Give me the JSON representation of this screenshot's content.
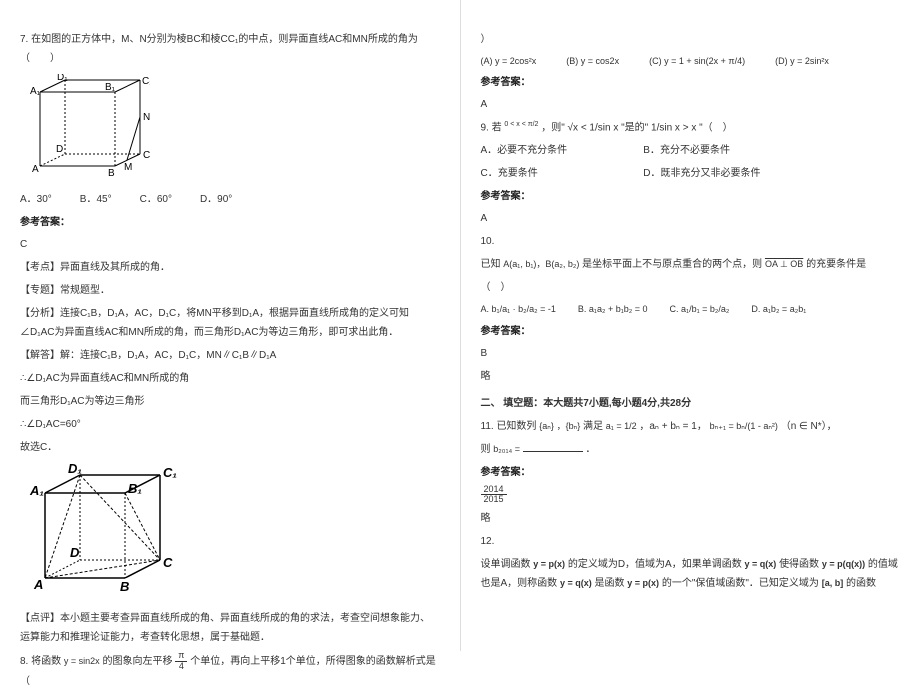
{
  "left": {
    "q7": "7. 在如图的正方体中，M、N分别为棱BC和棱CC₁的中点，则异面直线AC和MN所成的角为（　　）",
    "q7_optA": "A．30°",
    "q7_optB": "B．45°",
    "q7_optC": "C．60°",
    "q7_optD": "D．90°",
    "ans_label": "参考答案：",
    "q7_ans": "C",
    "kd_label": "【考点】异面直线及其所成的角．",
    "zt_label": "【专题】常规题型．",
    "fx_label": "【分析】连接C₁B，D₁A，AC，D₁C，将MN平移到D₁A，根据异面直线所成角的定义可知∠D₁AC为异面直线AC和MN所成的角，而三角形D₁AC为等边三角形，即可求出此角．",
    "jd_label": "【解答】解：连接C₁B，D₁A，AC，D₁C，MN∥C₁B∥D₁A",
    "line1": "∴∠D₁AC为异面直线AC和MN所成的角",
    "line2": "而三角形D₁AC为等边三角形",
    "line3": "∴∠D₁AC=60°",
    "line4": "故选C．",
    "dp_label": "【点评】本小题主要考查异面直线所成的角、异面直线所成的角的求法，考查空间想象能力、运算能力和推理论证能力，考查转化思想，属于基础题．",
    "q8_a": "8. 将函数",
    "q8_b": "的图象向左平移",
    "q8_c": "个单位，再向上平移1个单位，所得图象的函数解析式是（",
    "q8_fn": "y = sin2x",
    "q8_frac_n": "π",
    "q8_frac_d": "4"
  },
  "right": {
    "paren": "）",
    "opt8A": "(A)",
    "opt8A_fn": "y = 2cos²x",
    "opt8B": "(B)",
    "opt8B_fn": "y = cos2x",
    "opt8C": "(C)",
    "opt8C_fn": "y = 1 + sin(2x + π/4)",
    "opt8D": "(D)",
    "opt8D_fn": "y = 2sin²x",
    "ans_label": "参考答案：",
    "q8_ans": "A",
    "q9_a": "9. 若",
    "q9_cond": "0 < x < π/2",
    "q9_b": "，则\"",
    "q9_mid": "√x < 1/sin x",
    "q9_c": "\"是的\"",
    "q9_right": "1/sin x > x",
    "q9_d": "\"（　）",
    "q9A": "A．必要不充分条件",
    "q9B": "B．充分不必要条件",
    "q9C": "C．充要条件",
    "q9D": "D．既非充分又非必要条件",
    "q9_ans": "A",
    "q10": "10.",
    "q10_text_a": "已知",
    "q10_pts": "A(a₁, b₁)，B(a₂, b₂)",
    "q10_text_b": "是坐标平面上不与原点重合的两个点，则",
    "q10_vec": "OA ⊥ OB",
    "q10_text_c": "的充要条件是",
    "q10_paren": "（　）",
    "q10A": "A.",
    "q10A_fn": "b₁/a₁ · b₂/a₂ = -1",
    "q10B": "B.",
    "q10B_fn": "a₁a₂ + b₁b₂ = 0",
    "q10C": "C.",
    "q10C_fn": "a₁/b₁ = b₂/a₂",
    "q10D": "D.",
    "q10D_fn": "a₁b₂ = a₂b₁",
    "q10_ans": "B",
    "slight": "略",
    "sec2": "二、 填空题：本大题共7小题,每小题4分,共28分",
    "q11_a": "11. 已知数列",
    "q11_seqa": "{aₙ}",
    "q11_seqb": "，{bₙ}",
    "q11_b": "满足",
    "q11_a1": "a₁ = 1/2",
    "q11_c": "，aₙ + bₙ = 1，",
    "q11_bn": "bₙ₊₁ = bₙ/(1 - aₙ²)",
    "q11_d": "（n ∈ N*），",
    "q11_e": "则",
    "q11_target": "b₂₀₁₄ =",
    "q11_blank": "．",
    "q11_ans_n": "2014",
    "q11_ans_d": "2015",
    "q12": "12.",
    "q12_a": "设单调函数",
    "q12_px": "y = p(x)",
    "q12_b": "的定义域为D，值域为A，如果单调函数",
    "q12_qx": "y = q(x)",
    "q12_c": "使得函数",
    "q12_pqx": "y = p(q(x))",
    "q12_d": "的值域也是A，则称函数",
    "q12_e": "是函数",
    "q12_f": "的一个\"保值域函数\"．已知定义域为",
    "q12_ab": "[a, b]",
    "q12_g": "的函数"
  }
}
